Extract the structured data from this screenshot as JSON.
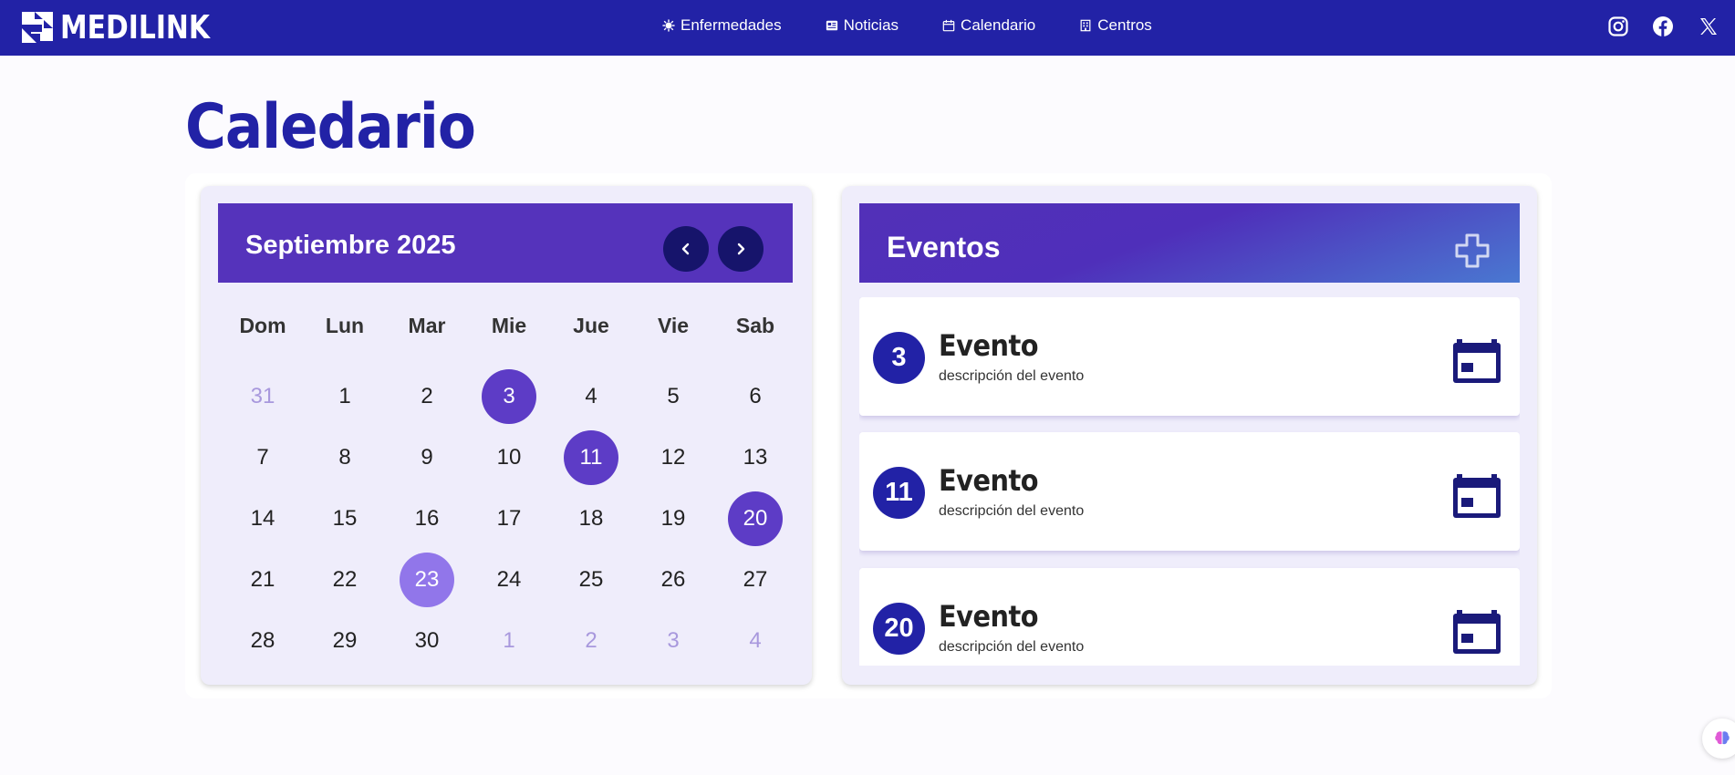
{
  "brand": {
    "name": "MEDILINK"
  },
  "nav": {
    "links": [
      {
        "label": "Enfermedades",
        "icon": "virus-icon"
      },
      {
        "label": "Noticias",
        "icon": "newspaper-icon"
      },
      {
        "label": "Calendario",
        "icon": "calendar-icon"
      },
      {
        "label": "Centros",
        "icon": "building-icon"
      }
    ],
    "social": [
      "instagram-icon",
      "facebook-icon",
      "x-icon"
    ]
  },
  "page": {
    "title": "Caledario"
  },
  "calendar": {
    "month_label": "Septiembre 2025",
    "weekdays": [
      "Dom",
      "Lun",
      "Mar",
      "Mie",
      "Jue",
      "Vie",
      "Sab"
    ],
    "weeks": [
      [
        "31",
        "1",
        "2",
        "3",
        "4",
        "5",
        "6"
      ],
      [
        "7",
        "8",
        "9",
        "10",
        "11",
        "12",
        "13"
      ],
      [
        "14",
        "15",
        "16",
        "17",
        "18",
        "19",
        "20"
      ],
      [
        "21",
        "22",
        "23",
        "24",
        "25",
        "26",
        "27"
      ],
      [
        "28",
        "29",
        "30",
        "1",
        "2",
        "3",
        "4"
      ]
    ],
    "event_days": [
      "3",
      "11",
      "20"
    ],
    "today": "23",
    "accent": "#5d3cc6",
    "today_color": "#9176ea"
  },
  "events": {
    "title": "Eventos",
    "items": [
      {
        "day": "3",
        "name": "Evento",
        "description": "descripción del evento"
      },
      {
        "day": "11",
        "name": "Evento",
        "description": "descripción del evento"
      },
      {
        "day": "20",
        "name": "Evento",
        "description": "descripción del evento"
      }
    ]
  },
  "colors": {
    "navbar": "#2222a6",
    "title": "#2222a6",
    "panel": "#efedfb"
  }
}
